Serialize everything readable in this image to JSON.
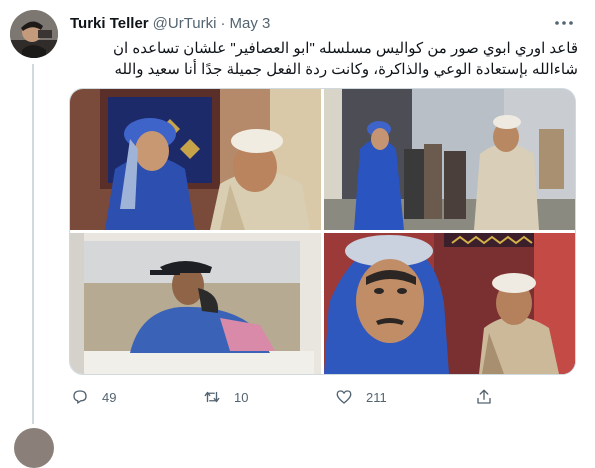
{
  "tweet": {
    "author_name": "Turki Teller",
    "author_handle": "@UrTurki",
    "separator": "·",
    "date": "May 3",
    "text": "قاعد اوري ابوي صور من كواليس مسلسله \"ابو العصافير\" علشان تساعده ان شاءالله بإستعادة الوعي والذاكرة، وكانت ردة الفعل جميلة جدًا أنا سعيد والله",
    "media": [
      {
        "icon": "photo-behind-scenes-1"
      },
      {
        "icon": "photo-behind-scenes-2"
      },
      {
        "icon": "photo-behind-scenes-3"
      },
      {
        "icon": "photo-behind-scenes-4"
      }
    ]
  },
  "actions": {
    "reply": {
      "icon": "reply-icon",
      "count": "49"
    },
    "retweet": {
      "icon": "retweet-icon",
      "count": "10"
    },
    "like": {
      "icon": "heart-icon",
      "count": "211"
    },
    "share": {
      "icon": "share-icon"
    }
  },
  "colors": {
    "text_primary": "#0f1419",
    "text_secondary": "#536471",
    "border": "#cfd9de"
  }
}
